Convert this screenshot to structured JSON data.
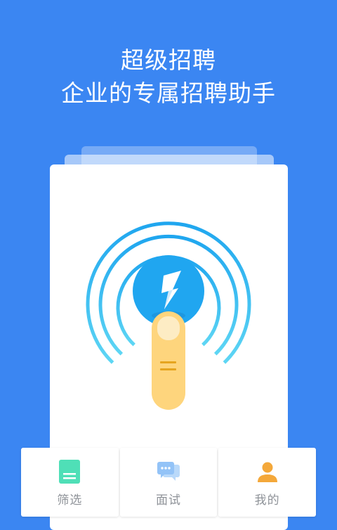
{
  "hero": {
    "title": "超级招聘",
    "subtitle": "企业的专属招聘助手"
  },
  "tabbar": {
    "items": [
      {
        "label": "筛选",
        "icon": "filter-card-icon",
        "color": "#4fdfb7"
      },
      {
        "label": "面试",
        "icon": "chat-bubbles-icon",
        "color": "#93c3f7"
      },
      {
        "label": "我的",
        "icon": "person-icon",
        "color": "#f4a83a"
      }
    ]
  },
  "colors": {
    "background": "#3b86f2",
    "card": "#ffffff",
    "badge": "#20a6f0",
    "finger": "#fed57d"
  }
}
